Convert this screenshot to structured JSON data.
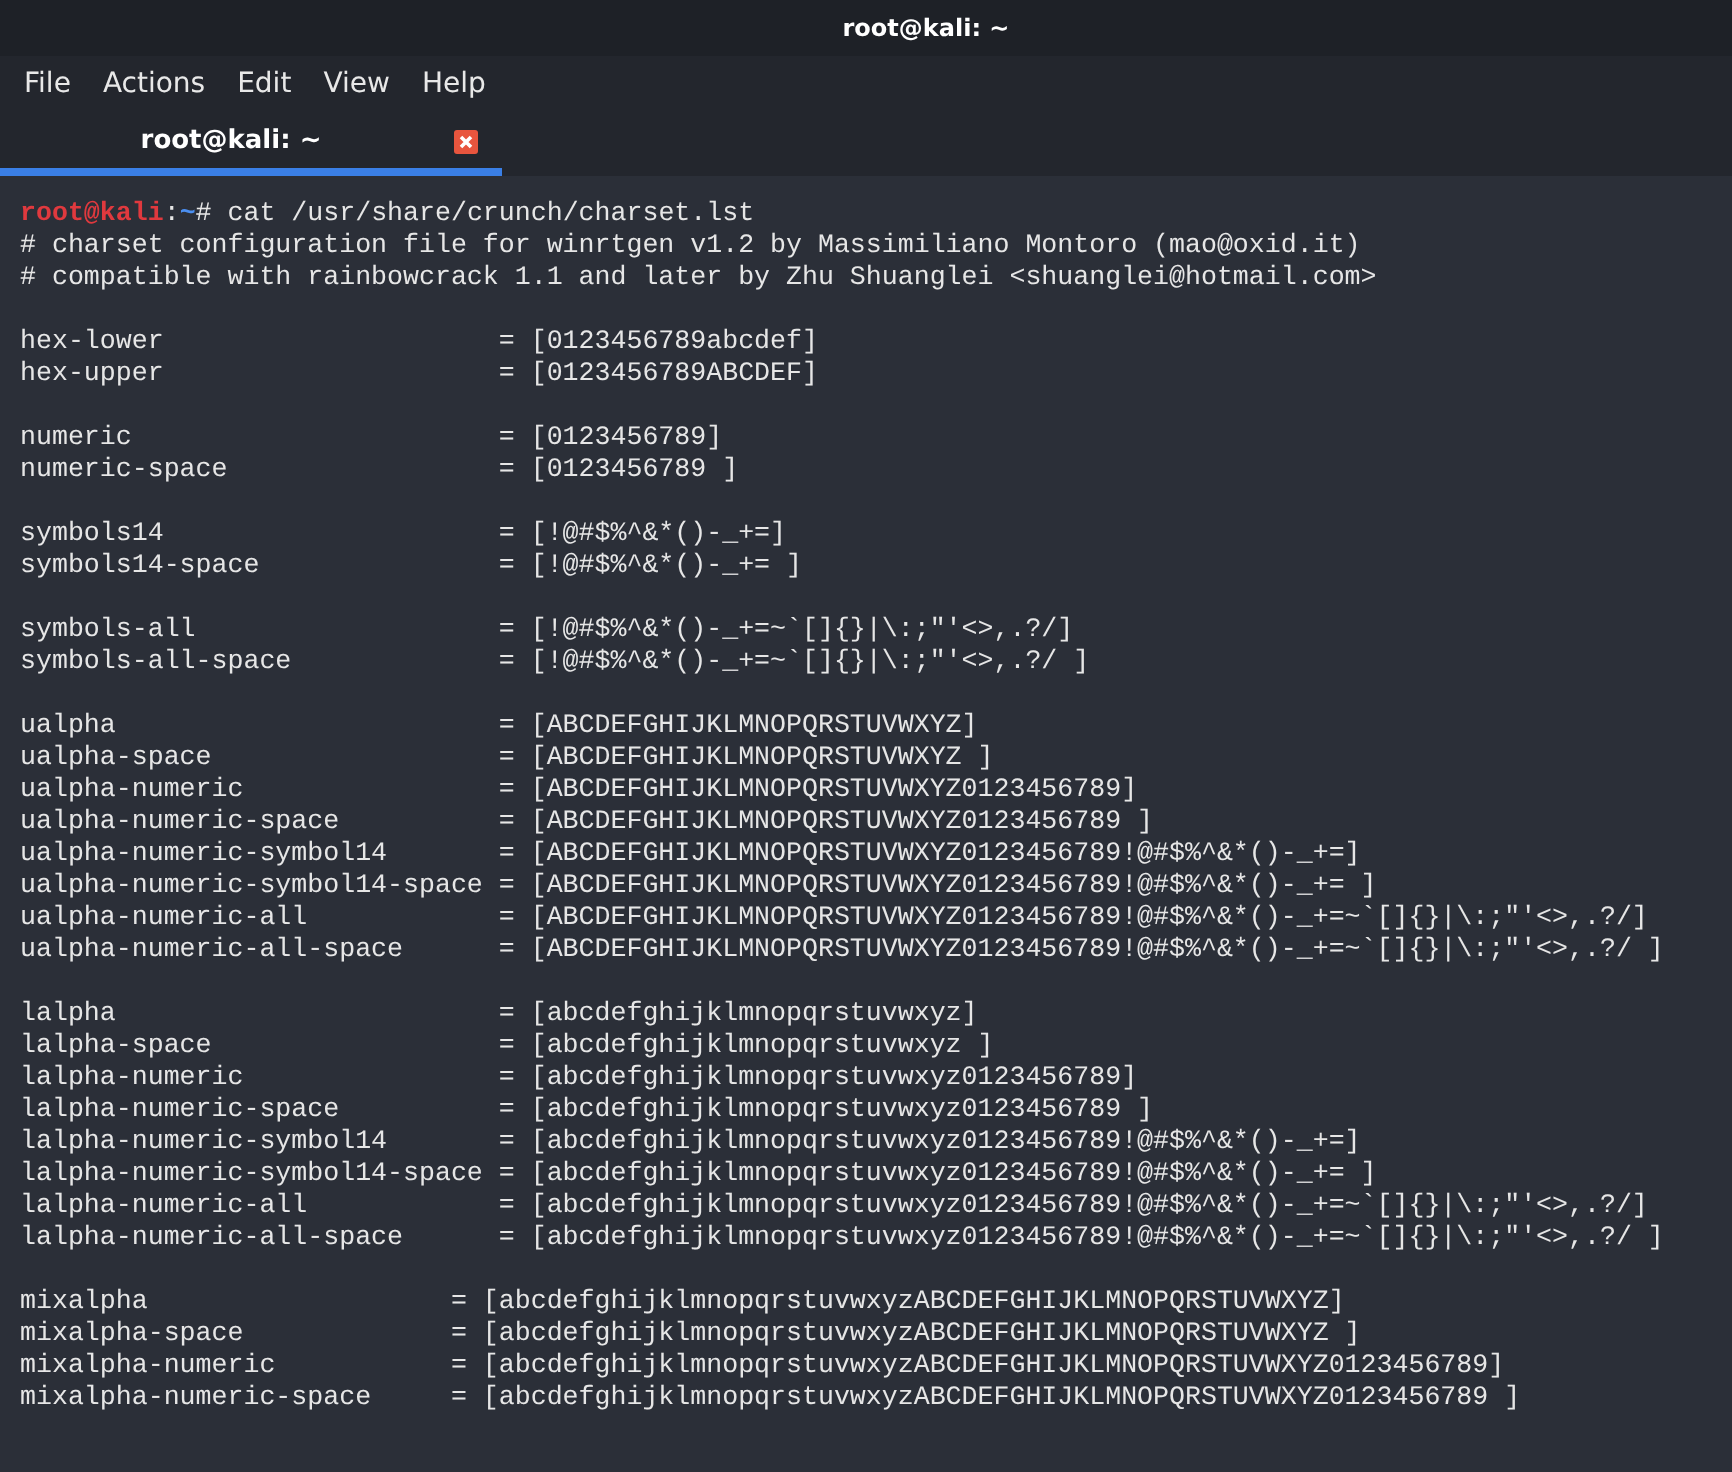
{
  "window": {
    "title": "root@kali: ~"
  },
  "menu": [
    "File",
    "Actions",
    "Edit",
    "View",
    "Help"
  ],
  "tabs": [
    {
      "label": "root@kali: ~",
      "selected": true
    }
  ],
  "terminal": {
    "prompt": {
      "user": "root@kali",
      "separator": ":",
      "path": "~",
      "symbol": "#",
      "command": " cat /usr/share/crunch/charset.lst"
    },
    "blocks": [
      [
        "# charset configuration file for winrtgen v1.2 by Massimiliano Montoro (mao@oxid.it)",
        "# compatible with rainbowcrack 1.1 and later by Zhu Shuanglei <shuanglei@hotmail.com>"
      ],
      [
        "hex-lower                     = [0123456789abcdef]",
        "hex-upper                     = [0123456789ABCDEF]"
      ],
      [
        "numeric                       = [0123456789]",
        "numeric-space                 = [0123456789 ]"
      ],
      [
        "symbols14                     = [!@#$%^&*()-_+=]",
        "symbols14-space               = [!@#$%^&*()-_+= ]"
      ],
      [
        "symbols-all                   = [!@#$%^&*()-_+=~`[]{}|\\:;\"'<>,.?/]",
        "symbols-all-space             = [!@#$%^&*()-_+=~`[]{}|\\:;\"'<>,.?/ ]"
      ],
      [
        "ualpha                        = [ABCDEFGHIJKLMNOPQRSTUVWXYZ]",
        "ualpha-space                  = [ABCDEFGHIJKLMNOPQRSTUVWXYZ ]",
        "ualpha-numeric                = [ABCDEFGHIJKLMNOPQRSTUVWXYZ0123456789]",
        "ualpha-numeric-space          = [ABCDEFGHIJKLMNOPQRSTUVWXYZ0123456789 ]",
        "ualpha-numeric-symbol14       = [ABCDEFGHIJKLMNOPQRSTUVWXYZ0123456789!@#$%^&*()-_+=]",
        "ualpha-numeric-symbol14-space = [ABCDEFGHIJKLMNOPQRSTUVWXYZ0123456789!@#$%^&*()-_+= ]",
        "ualpha-numeric-all            = [ABCDEFGHIJKLMNOPQRSTUVWXYZ0123456789!@#$%^&*()-_+=~`[]{}|\\:;\"'<>,.?/]",
        "ualpha-numeric-all-space      = [ABCDEFGHIJKLMNOPQRSTUVWXYZ0123456789!@#$%^&*()-_+=~`[]{}|\\:;\"'<>,.?/ ]"
      ],
      [
        "lalpha                        = [abcdefghijklmnopqrstuvwxyz]",
        "lalpha-space                  = [abcdefghijklmnopqrstuvwxyz ]",
        "lalpha-numeric                = [abcdefghijklmnopqrstuvwxyz0123456789]",
        "lalpha-numeric-space          = [abcdefghijklmnopqrstuvwxyz0123456789 ]",
        "lalpha-numeric-symbol14       = [abcdefghijklmnopqrstuvwxyz0123456789!@#$%^&*()-_+=]",
        "lalpha-numeric-symbol14-space = [abcdefghijklmnopqrstuvwxyz0123456789!@#$%^&*()-_+= ]",
        "lalpha-numeric-all            = [abcdefghijklmnopqrstuvwxyz0123456789!@#$%^&*()-_+=~`[]{}|\\:;\"'<>,.?/]",
        "lalpha-numeric-all-space      = [abcdefghijklmnopqrstuvwxyz0123456789!@#$%^&*()-_+=~`[]{}|\\:;\"'<>,.?/ ]"
      ],
      [
        "mixalpha                   = [abcdefghijklmnopqrstuvwxyzABCDEFGHIJKLMNOPQRSTUVWXYZ]",
        "mixalpha-space             = [abcdefghijklmnopqrstuvwxyzABCDEFGHIJKLMNOPQRSTUVWXYZ ]",
        "mixalpha-numeric           = [abcdefghijklmnopqrstuvwxyzABCDEFGHIJKLMNOPQRSTUVWXYZ0123456789]",
        "mixalpha-numeric-space     = [abcdefghijklmnopqrstuvwxyzABCDEFGHIJKLMNOPQRSTUVWXYZ0123456789 ]"
      ]
    ]
  }
}
